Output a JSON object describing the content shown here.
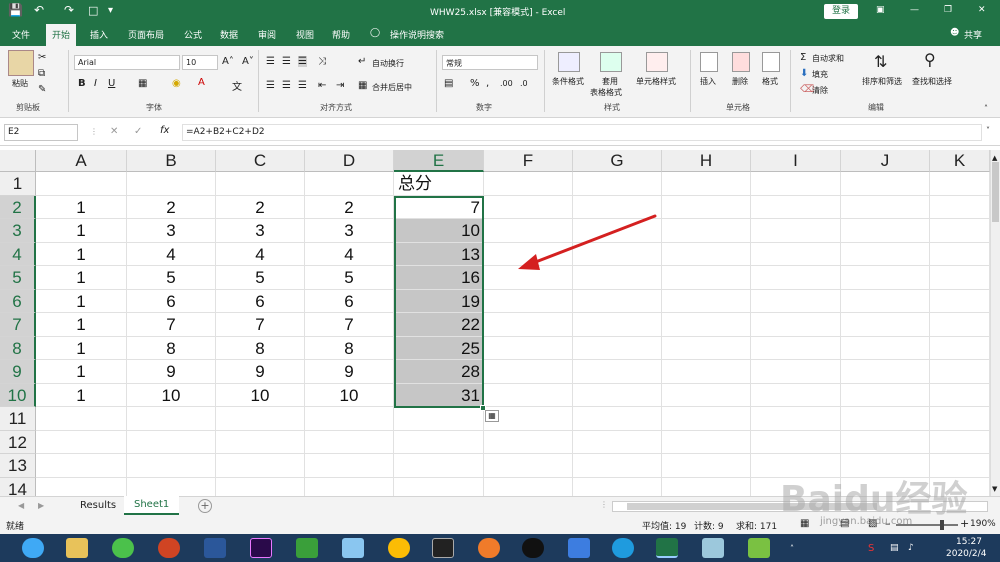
{
  "window": {
    "title": "WHW25.xlsx [兼容模式] - Excel",
    "login_label": "登录",
    "share_label": "共享"
  },
  "menu": {
    "tabs": [
      "文件",
      "开始",
      "插入",
      "页面布局",
      "公式",
      "数据",
      "审阅",
      "视图",
      "帮助"
    ],
    "active_tab": "开始",
    "tell_me": "操作说明搜索"
  },
  "ribbon": {
    "clipboard": {
      "paste": "粘贴",
      "label": "剪贴板"
    },
    "font": {
      "name": "Arial",
      "size": "10",
      "label": "字体"
    },
    "alignment": {
      "wrap": "自动换行",
      "merge": "合并后居中",
      "label": "对齐方式"
    },
    "number": {
      "format": "常规",
      "label": "数字"
    },
    "styles": {
      "conditional": "条件格式",
      "table_line1": "套用",
      "table_line2": "表格格式",
      "cell_styles": "单元格样式",
      "label": "样式"
    },
    "cells": {
      "insert": "插入",
      "delete": "删除",
      "format": "格式",
      "label": "单元格"
    },
    "editing": {
      "autosum": "自动求和",
      "fill": "填充",
      "clear": "清除",
      "sort": "排序和筛选",
      "find": "查找和选择",
      "label": "编辑"
    }
  },
  "formula_bar": {
    "name_box": "E2",
    "formula": "=A2+B2+C2+D2"
  },
  "grid": {
    "columns": [
      "A",
      "B",
      "C",
      "D",
      "E",
      "F",
      "G",
      "H",
      "I",
      "J",
      "K"
    ],
    "rows": [
      "1",
      "2",
      "3",
      "4",
      "5",
      "6",
      "7",
      "8",
      "9",
      "10",
      "11",
      "12",
      "13",
      "14"
    ],
    "header_cell": "总分",
    "data": [
      [
        "1",
        "2",
        "2",
        "2",
        "7"
      ],
      [
        "1",
        "3",
        "3",
        "3",
        "10"
      ],
      [
        "1",
        "4",
        "4",
        "4",
        "13"
      ],
      [
        "1",
        "5",
        "5",
        "5",
        "16"
      ],
      [
        "1",
        "6",
        "6",
        "6",
        "19"
      ],
      [
        "1",
        "7",
        "7",
        "7",
        "22"
      ],
      [
        "1",
        "8",
        "8",
        "8",
        "25"
      ],
      [
        "1",
        "9",
        "9",
        "9",
        "28"
      ],
      [
        "1",
        "10",
        "10",
        "10",
        "31"
      ]
    ]
  },
  "sheets": {
    "tabs": [
      "Results",
      "Sheet1"
    ],
    "active": "Sheet1"
  },
  "status": {
    "ready": "就绪",
    "average": "平均值: 19",
    "count": "计数: 9",
    "sum": "求和: 171",
    "zoom": "190%"
  },
  "taskbar": {
    "time": "15:27",
    "date": "2020/2/4"
  },
  "watermark": {
    "text": "Baidu经验",
    "url": "jingyan.baidu.com"
  },
  "colors": {
    "excel_green": "#217346",
    "arrow_red": "#d42020",
    "selection_gray": "#c6c6c6"
  }
}
